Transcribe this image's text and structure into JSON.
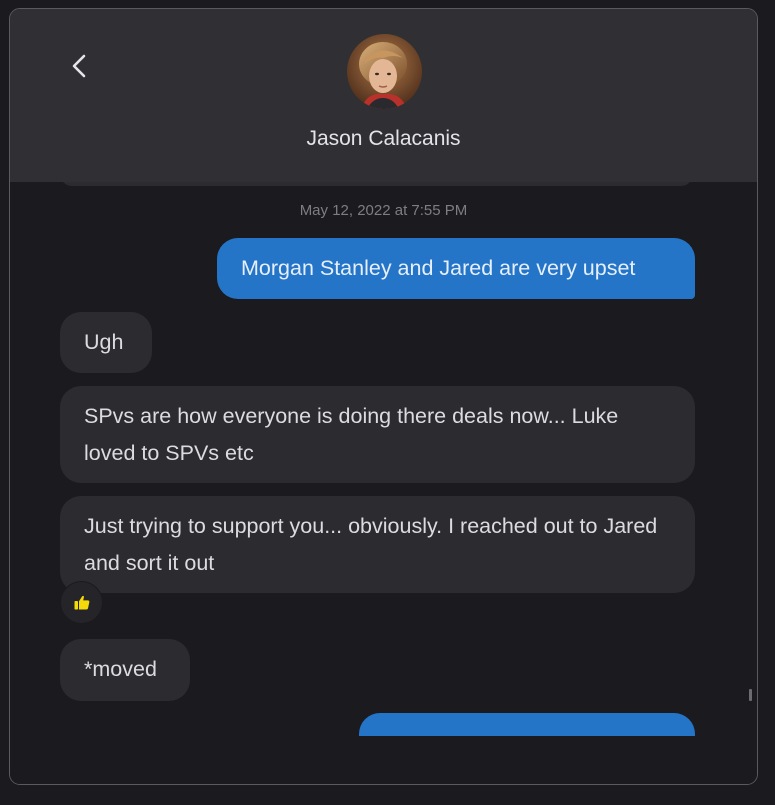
{
  "header": {
    "contact_name": "Jason Calacanis"
  },
  "thread": {
    "timestamp": "May 12, 2022 at 7:55 PM",
    "messages": [
      {
        "direction": "outgoing",
        "text": "Morgan Stanley and Jared are very upset"
      },
      {
        "direction": "incoming",
        "text": "Ugh"
      },
      {
        "direction": "incoming",
        "text": "SPvs are how everyone is doing there deals now... Luke loved to SPVs etc"
      },
      {
        "direction": "incoming",
        "text": "Just trying to support you... obviously. I reached out to Jared and sort it out",
        "reaction": "thumbs-up"
      },
      {
        "direction": "incoming",
        "text": "*moved"
      },
      {
        "direction": "outgoing",
        "text": ""
      }
    ]
  },
  "colors": {
    "outgoing_bubble": "#2475c8",
    "incoming_bubble": "#2b2b30",
    "header_bg": "#2f2f34",
    "background": "#1b1b1f",
    "reaction_icon": "#f5d90a"
  },
  "icons": {
    "back": "chevron-left-icon",
    "reaction": "thumbs-up-icon"
  }
}
